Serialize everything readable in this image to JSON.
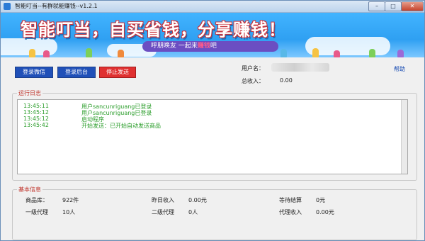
{
  "window": {
    "title": "智能叮当--有群就能赚钱--v1.2.1",
    "min_label": "–",
    "max_label": "□",
    "close_label": "✕"
  },
  "banner": {
    "slogan": "智能叮当，自买省钱，分享赚钱！",
    "ribbon_prefix": "呼朋唤友 一起来",
    "ribbon_highlight": "赚钱",
    "ribbon_suffix": "吧"
  },
  "toolbar": {
    "login_wechat": "登录微信",
    "login_admin": "登录后台",
    "stop_send": "停止发送"
  },
  "account": {
    "username_label": "用户名：",
    "income_label": "总收入：",
    "income_value": "0.00",
    "help_label": "帮助"
  },
  "log": {
    "title": "运行日志",
    "lines": [
      {
        "time": "13:45:11",
        "message": "用户sancunriguang已登录"
      },
      {
        "time": "13:45:12",
        "message": "用户sancunriguang已登录"
      },
      {
        "time": "13:45:12",
        "message": "启动程序"
      },
      {
        "time": "13:45:42",
        "message": "开始发送：已开始自动发送商品"
      }
    ]
  },
  "info": {
    "title": "基本信息",
    "product_label": "商品库：",
    "product_value": "922件",
    "yesterday_label": "昨日收入",
    "yesterday_value": "0.00元",
    "pending_label": "等待结算",
    "pending_value": "0元",
    "level1_label": "一级代理",
    "level1_value": "10人",
    "level2_label": "二级代理",
    "level2_value": "0人",
    "agent_income_label": "代理收入",
    "agent_income_value": "0.00元"
  },
  "colors": {
    "accent_blue": "#2050b8",
    "stop_red": "#e03030",
    "log_green": "#2a9d2a",
    "group_title_red": "#c0342b"
  }
}
